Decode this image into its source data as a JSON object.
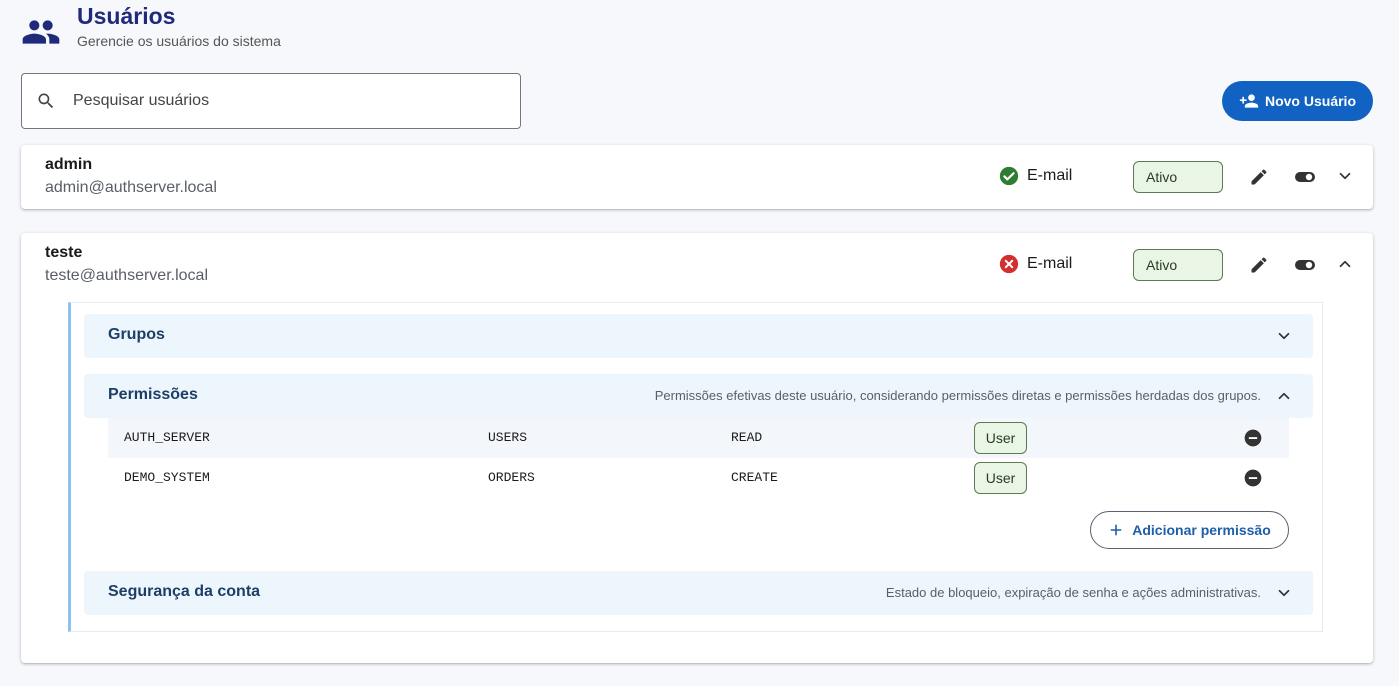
{
  "header": {
    "icon": "group-icon",
    "title": "Usuários",
    "subtitle": "Gerencie os usuários do sistema"
  },
  "search": {
    "icon": "search-icon",
    "placeholder": "Pesquisar usuários",
    "value": ""
  },
  "new_user_button": {
    "icon": "person-add-icon",
    "label": "Novo Usuário"
  },
  "users": [
    {
      "name": "admin",
      "email": "admin@authserver.local",
      "email_status_label": "E-mail",
      "email_verified": true,
      "status": "Ativo",
      "expanded": false
    },
    {
      "name": "teste",
      "email": "teste@authserver.local",
      "email_status_label": "E-mail",
      "email_verified": false,
      "status": "Ativo",
      "expanded": true,
      "sections": {
        "groups": {
          "title": "Grupos",
          "expanded": false
        },
        "permissions": {
          "title": "Permissões",
          "description": "Permissões efetivas deste usuário, considerando permissões diretas e permissões herdadas dos grupos.",
          "expanded": true,
          "rows": [
            {
              "system": "AUTH_SERVER",
              "resource": "USERS",
              "action": "READ",
              "source": "User"
            },
            {
              "system": "DEMO_SYSTEM",
              "resource": "ORDERS",
              "action": "CREATE",
              "source": "User"
            }
          ],
          "add_label": "Adicionar permissão"
        },
        "security": {
          "title": "Segurança da conta",
          "description": "Estado de bloqueio, expiração de senha e ações administrativas.",
          "expanded": false
        }
      }
    }
  ],
  "colors": {
    "primary": "#1162c2",
    "title": "#1f2a7a",
    "verified": "#2e7d32",
    "unverified": "#d32f2f",
    "active_badge_bg": "#e9f5e5",
    "section_bg": "#edf5fd",
    "detail_accent": "#8ac2f2"
  }
}
